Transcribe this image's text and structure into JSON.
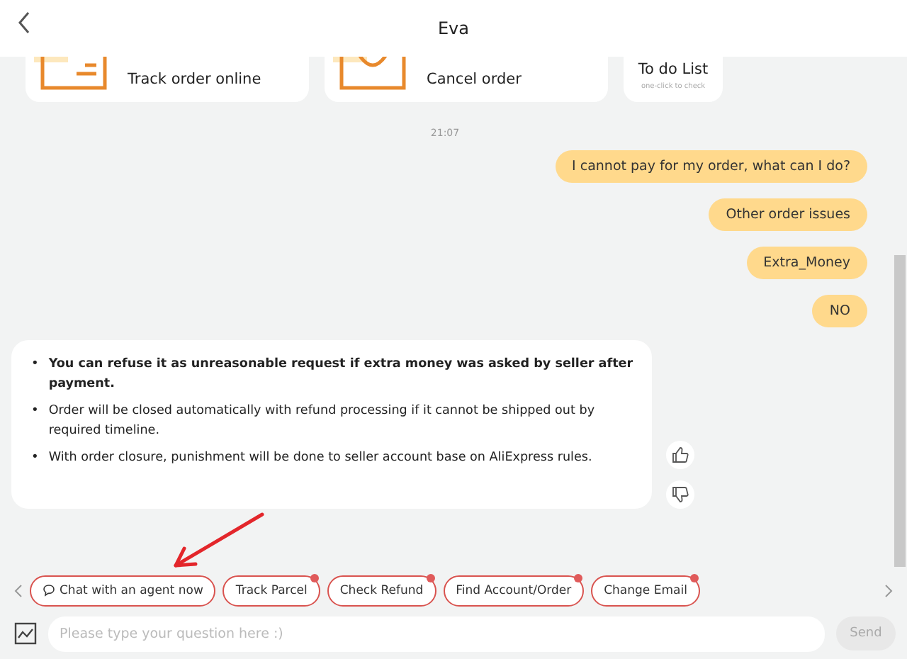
{
  "header": {
    "title": "Eva"
  },
  "service_cards": [
    {
      "kind": "box",
      "label": "Track order online"
    },
    {
      "kind": "bag",
      "label": "Cancel order"
    }
  ],
  "todo_card": {
    "title": "To do List",
    "subtitle": "one-click to check"
  },
  "timestamp": "21:07",
  "user_messages": [
    "I cannot pay for my order, what can I do?",
    "Other order issues",
    "Extra_Money",
    "NO"
  ],
  "bot_message": {
    "items": [
      {
        "bullet": "•",
        "text": "You can refuse it as unreasonable request if extra money was asked by seller after payment.",
        "bold": true
      },
      {
        "bullet": "•",
        "text": "Order will be closed automatically with refund processing if it cannot be shipped out by required timeline.",
        "bold": false
      },
      {
        "bullet": "•",
        "text": "With order closure, punishment will be done to seller account base on AliExpress rules.",
        "bold": false
      }
    ]
  },
  "quick_replies": [
    {
      "label": "Chat with an agent now",
      "kind": "chat",
      "badge": false
    },
    {
      "label": "Track Parcel",
      "kind": "plain",
      "badge": true
    },
    {
      "label": "Check Refund",
      "kind": "plain",
      "badge": true
    },
    {
      "label": "Find Account/Order",
      "kind": "plain",
      "badge": true
    },
    {
      "label": "Change Email",
      "kind": "plain",
      "badge": true
    }
  ],
  "composer": {
    "placeholder": "Please type your question here :)",
    "send": "Send"
  }
}
